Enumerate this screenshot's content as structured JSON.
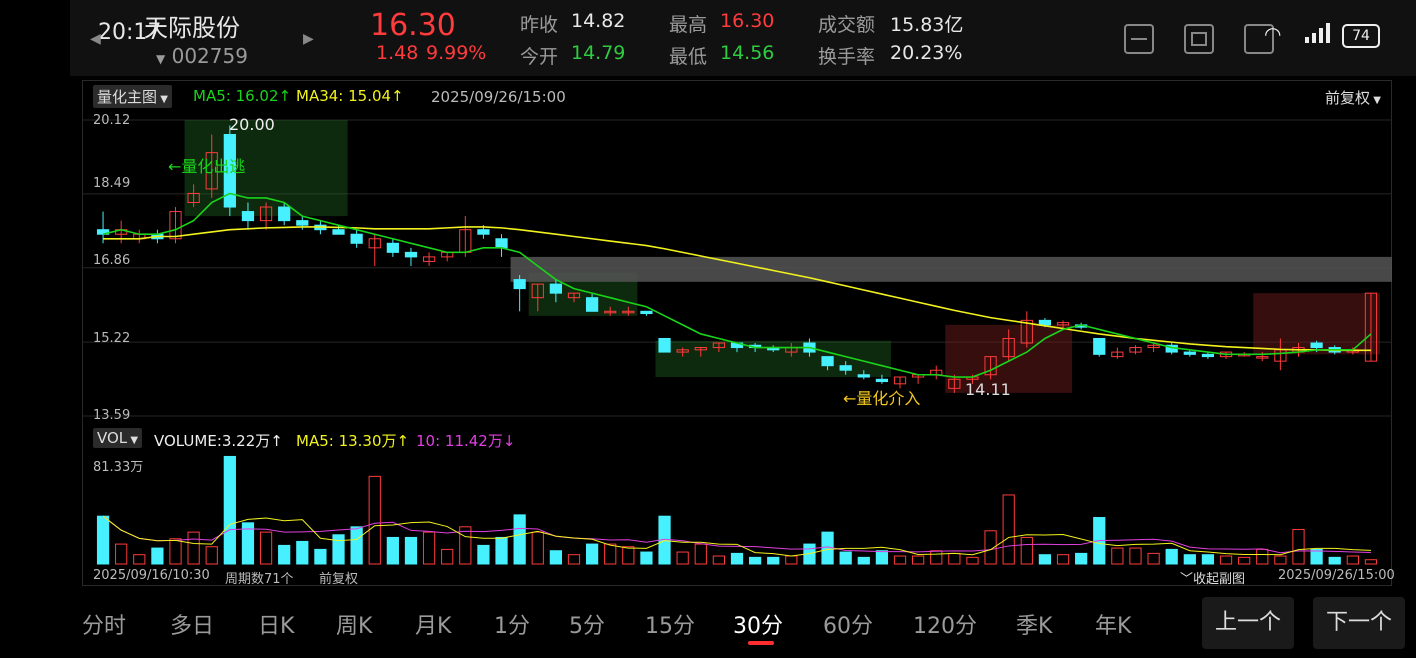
{
  "status_bar": {
    "time": "20:17",
    "battery": "74"
  },
  "stock": {
    "name": "天际股份",
    "code": "002759",
    "price": "16.30",
    "change": "1.48",
    "change_pct": "9.99%"
  },
  "quote": {
    "prev_close_label": "昨收",
    "prev_close": "14.82",
    "open_label": "今开",
    "open": "14.79",
    "high_label": "最高",
    "high": "16.30",
    "low_label": "最低",
    "low": "14.56",
    "turnover_label": "成交额",
    "turnover": "15.83亿",
    "turnover_rate_label": "换手率",
    "turnover_rate": "20.23%"
  },
  "main_chart": {
    "indicator_select": "量化主图",
    "ma5": "MA5: 16.02↑",
    "ma34": "MA34: 15.04↑",
    "datetime": "2025/09/26/15:00",
    "adjust": "前复权",
    "y_ticks": [
      "20.12",
      "18.49",
      "16.86",
      "15.22",
      "13.59"
    ],
    "peak_label": "20.00",
    "trough_label": "14.11",
    "exit_signal": "←量化出逃",
    "entry_signal": "←量化介入",
    "colors": {
      "up": "#ff3b3b",
      "down": "#46f0ff",
      "ma5": "#19d419",
      "ma34": "#f2f21e"
    }
  },
  "vol_chart": {
    "indicator_select": "VOL",
    "volume": "VOLUME:3.22万↑",
    "ma5": "MA5: 13.30万↑",
    "ma10": "10: 11.42万↓",
    "y_top": "81.33万"
  },
  "footer_info": {
    "start": "2025/09/16/10:30",
    "period_count": "周期数71个",
    "adjust": "前复权",
    "collapse": "收起副图",
    "end": "2025/09/26/15:00"
  },
  "tabs": [
    "分时",
    "多日",
    "日K",
    "周K",
    "月K",
    "1分",
    "5分",
    "15分",
    "30分",
    "60分",
    "120分",
    "季K",
    "年K"
  ],
  "active_tab": "30分",
  "nav": {
    "prev": "上一个",
    "next": "下一个"
  },
  "chart_data": {
    "type": "candlestick",
    "ohlc": [
      [
        17.7,
        18.1,
        17.4,
        17.6
      ],
      [
        17.6,
        17.9,
        17.4,
        17.7
      ],
      [
        17.5,
        17.7,
        17.4,
        17.6
      ],
      [
        17.6,
        17.7,
        17.4,
        17.5
      ],
      [
        17.5,
        18.2,
        17.4,
        18.1
      ],
      [
        18.3,
        18.7,
        18.2,
        18.5
      ],
      [
        18.6,
        19.8,
        18.4,
        19.4
      ],
      [
        19.8,
        20.0,
        18.0,
        18.2
      ],
      [
        18.1,
        18.3,
        17.7,
        17.9
      ],
      [
        17.9,
        18.3,
        17.7,
        18.2
      ],
      [
        18.2,
        18.3,
        17.8,
        17.9
      ],
      [
        17.9,
        18.0,
        17.7,
        17.8
      ],
      [
        17.8,
        17.9,
        17.6,
        17.7
      ],
      [
        17.7,
        17.8,
        17.6,
        17.6
      ],
      [
        17.6,
        17.7,
        17.3,
        17.4
      ],
      [
        17.3,
        17.6,
        16.9,
        17.5
      ],
      [
        17.4,
        17.5,
        17.1,
        17.2
      ],
      [
        17.2,
        17.3,
        16.9,
        17.1
      ],
      [
        17.0,
        17.2,
        16.9,
        17.1
      ],
      [
        17.1,
        17.2,
        17.0,
        17.2
      ],
      [
        17.2,
        18.0,
        17.1,
        17.7
      ],
      [
        17.7,
        17.8,
        17.5,
        17.6
      ],
      [
        17.5,
        17.6,
        17.1,
        17.3
      ],
      [
        16.6,
        16.7,
        15.9,
        16.4
      ],
      [
        16.2,
        16.5,
        15.9,
        16.5
      ],
      [
        16.5,
        16.6,
        16.1,
        16.3
      ],
      [
        16.2,
        16.3,
        16.1,
        16.3
      ],
      [
        16.2,
        16.3,
        15.9,
        15.9
      ],
      [
        15.9,
        16.0,
        15.8,
        15.9
      ],
      [
        15.9,
        16.0,
        15.8,
        15.9
      ],
      [
        15.9,
        15.9,
        15.8,
        15.85
      ],
      [
        15.3,
        15.3,
        15.0,
        15.0
      ],
      [
        15.0,
        15.1,
        14.9,
        15.05
      ],
      [
        15.05,
        15.1,
        14.9,
        15.1
      ],
      [
        15.1,
        15.2,
        15.0,
        15.2
      ],
      [
        15.2,
        15.2,
        15.0,
        15.1
      ],
      [
        15.15,
        15.2,
        15.0,
        15.1
      ],
      [
        15.1,
        15.15,
        15.0,
        15.05
      ],
      [
        15.0,
        15.2,
        14.9,
        15.1
      ],
      [
        15.2,
        15.3,
        14.9,
        15.0
      ],
      [
        14.9,
        14.9,
        14.6,
        14.7
      ],
      [
        14.7,
        14.8,
        14.5,
        14.6
      ],
      [
        14.5,
        14.6,
        14.4,
        14.45
      ],
      [
        14.4,
        14.5,
        14.3,
        14.35
      ],
      [
        14.3,
        14.45,
        14.2,
        14.45
      ],
      [
        14.45,
        14.5,
        14.3,
        14.5
      ],
      [
        14.5,
        14.7,
        14.4,
        14.6
      ],
      [
        14.2,
        14.5,
        14.1,
        14.4
      ],
      [
        14.4,
        14.5,
        14.3,
        14.45
      ],
      [
        14.5,
        14.9,
        14.4,
        14.9
      ],
      [
        14.9,
        15.5,
        14.8,
        15.3
      ],
      [
        15.2,
        15.9,
        15.1,
        15.7
      ],
      [
        15.7,
        15.75,
        15.55,
        15.6
      ],
      [
        15.6,
        15.7,
        15.5,
        15.65
      ],
      [
        15.6,
        15.65,
        15.5,
        15.55
      ],
      [
        15.3,
        15.3,
        14.9,
        14.95
      ],
      [
        14.9,
        15.1,
        14.85,
        15.0
      ],
      [
        15.0,
        15.15,
        14.95,
        15.1
      ],
      [
        15.1,
        15.2,
        15.0,
        15.15
      ],
      [
        15.15,
        15.2,
        14.95,
        15.0
      ],
      [
        15.0,
        15.05,
        14.9,
        14.95
      ],
      [
        14.95,
        15.0,
        14.85,
        14.9
      ],
      [
        14.9,
        15.0,
        14.85,
        15.0
      ],
      [
        14.95,
        15.0,
        14.9,
        14.95
      ],
      [
        14.9,
        15.0,
        14.8,
        14.9
      ],
      [
        14.8,
        15.3,
        14.6,
        15.05
      ],
      [
        15.0,
        15.2,
        14.9,
        15.1
      ],
      [
        15.2,
        15.25,
        15.0,
        15.1
      ],
      [
        15.1,
        15.15,
        14.95,
        15.0
      ],
      [
        15.0,
        15.1,
        14.95,
        15.05
      ],
      [
        14.8,
        16.3,
        14.8,
        16.3
      ]
    ],
    "volume": [
      36,
      15,
      7,
      12,
      19,
      24,
      13,
      81,
      31,
      24,
      14,
      17,
      11,
      22,
      28,
      66,
      20,
      20,
      24,
      11,
      28,
      14,
      20,
      37,
      24,
      10,
      7,
      15,
      15,
      13,
      9,
      36,
      9,
      15,
      6,
      8,
      5,
      5,
      6,
      15,
      24,
      9,
      5,
      10,
      6,
      6,
      10,
      8,
      5,
      25,
      52,
      20,
      7,
      7,
      8,
      35,
      12,
      12,
      8,
      11,
      7,
      7,
      6,
      5,
      11,
      6,
      26,
      11,
      5,
      6,
      3.22
    ],
    "ma5": [
      17.6,
      17.7,
      17.6,
      17.6,
      17.7,
      17.9,
      18.3,
      18.5,
      18.4,
      18.4,
      18.3,
      18.0,
      17.9,
      17.8,
      17.7,
      17.6,
      17.5,
      17.4,
      17.3,
      17.2,
      17.2,
      17.3,
      17.3,
      17.2,
      16.9,
      16.6,
      16.4,
      16.3,
      16.2,
      16.1,
      16.0,
      15.8,
      15.6,
      15.4,
      15.3,
      15.2,
      15.1,
      15.1,
      15.1,
      15.1,
      15.0,
      14.9,
      14.8,
      14.7,
      14.6,
      14.5,
      14.5,
      14.45,
      14.45,
      14.6,
      14.8,
      15.0,
      15.3,
      15.5,
      15.6,
      15.5,
      15.4,
      15.3,
      15.2,
      15.1,
      15.05,
      15.0,
      14.95,
      14.95,
      14.95,
      14.97,
      15.0,
      15.05,
      15.05,
      15.05,
      15.4
    ],
    "ma34": [
      17.5,
      17.5,
      17.5,
      17.55,
      17.55,
      17.6,
      17.65,
      17.7,
      17.72,
      17.74,
      17.75,
      17.76,
      17.76,
      17.75,
      17.74,
      17.72,
      17.72,
      17.72,
      17.72,
      17.74,
      17.76,
      17.76,
      17.74,
      17.7,
      17.65,
      17.6,
      17.55,
      17.5,
      17.45,
      17.4,
      17.35,
      17.28,
      17.2,
      17.12,
      17.04,
      16.96,
      16.88,
      16.8,
      16.72,
      16.64,
      16.55,
      16.46,
      16.37,
      16.28,
      16.19,
      16.1,
      16.01,
      15.92,
      15.84,
      15.76,
      15.7,
      15.64,
      15.58,
      15.52,
      15.46,
      15.4,
      15.35,
      15.3,
      15.26,
      15.22,
      15.18,
      15.15,
      15.12,
      15.1,
      15.08,
      15.06,
      15.05,
      15.05,
      15.04,
      15.04,
      15.04
    ],
    "ylim": [
      13.59,
      20.12
    ],
    "vol_max": 81.33,
    "y_ticks": [
      20.12,
      18.49,
      16.86,
      15.22,
      13.59
    ]
  }
}
